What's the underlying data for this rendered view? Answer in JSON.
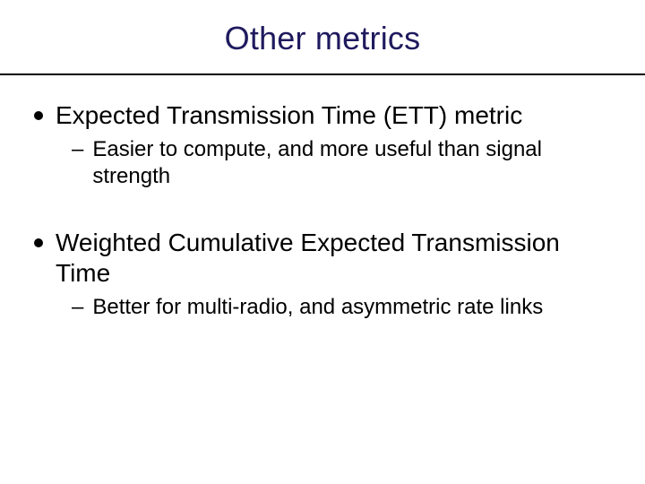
{
  "title": "Other metrics",
  "bullets": [
    {
      "text": "Expected Transmission Time (ETT) metric",
      "sub": [
        "Easier to compute, and more useful than signal strength"
      ]
    },
    {
      "text": "Weighted Cumulative Expected Transmission Time",
      "sub": [
        "Better for multi-radio, and asymmetric rate links"
      ]
    }
  ]
}
